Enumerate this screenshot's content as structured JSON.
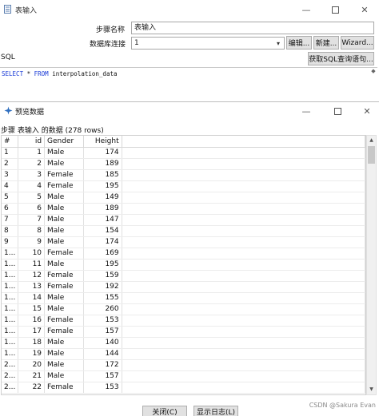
{
  "back_window": {
    "title": "表输入",
    "step_name_label": "步骤名称",
    "step_name_value": "表输入",
    "connection_label": "数据库连接",
    "connection_value": "1",
    "edit_button": "编辑...",
    "new_button": "新建...",
    "wizard_button": "Wizard...",
    "get_sql_button": "获取SQL查询语句...",
    "sql_label": "SQL",
    "sql_query": {
      "kw1": "SELECT",
      "star": " * ",
      "kw2": "FROM",
      "table": " interpolation_data"
    }
  },
  "preview_window": {
    "title": "预览数据",
    "subtitle": "步骤 表输入 的数据 (278 rows)",
    "columns": [
      "#",
      "id",
      "Gender",
      "Height"
    ],
    "rows": [
      [
        "1",
        "1",
        "Male",
        "174"
      ],
      [
        "2",
        "2",
        "Male",
        "189"
      ],
      [
        "3",
        "3",
        "Female",
        "185"
      ],
      [
        "4",
        "4",
        "Female",
        "195"
      ],
      [
        "5",
        "5",
        "Male",
        "149"
      ],
      [
        "6",
        "6",
        "Male",
        "189"
      ],
      [
        "7",
        "7",
        "Male",
        "147"
      ],
      [
        "8",
        "8",
        "Male",
        "154"
      ],
      [
        "9",
        "9",
        "Male",
        "174"
      ],
      [
        "1...",
        "10",
        "Female",
        "169"
      ],
      [
        "1...",
        "11",
        "Male",
        "195"
      ],
      [
        "1...",
        "12",
        "Female",
        "159"
      ],
      [
        "1...",
        "13",
        "Female",
        "192"
      ],
      [
        "1...",
        "14",
        "Male",
        "155"
      ],
      [
        "1...",
        "15",
        "Male",
        "260"
      ],
      [
        "1...",
        "16",
        "Female",
        "153"
      ],
      [
        "1...",
        "17",
        "Female",
        "157"
      ],
      [
        "1...",
        "18",
        "Male",
        "140"
      ],
      [
        "1...",
        "19",
        "Male",
        "144"
      ],
      [
        "2...",
        "20",
        "Male",
        "172"
      ],
      [
        "2...",
        "21",
        "Male",
        "157"
      ],
      [
        "2...",
        "22",
        "Female",
        "153"
      ]
    ],
    "close_button": "关闭(C)",
    "log_button": "显示日志(L)",
    "watermark": "CSDN @Sakura Evan"
  }
}
